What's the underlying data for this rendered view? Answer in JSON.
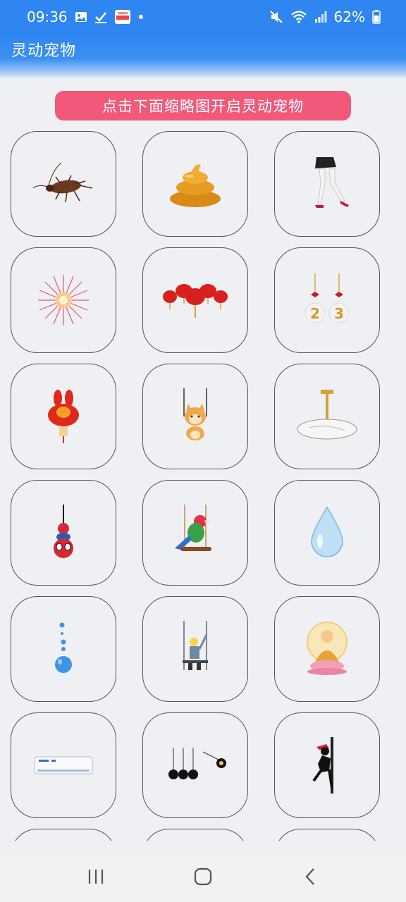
{
  "status_bar": {
    "time": "09:36",
    "battery": "62%",
    "icons": [
      "gallery-icon",
      "checkmark-icon",
      "app-notification-icon",
      "dot-icon",
      "mute-icon",
      "wifi-icon",
      "signal-icon",
      "battery-icon"
    ]
  },
  "header": {
    "title": "灵动宠物"
  },
  "banner": {
    "text": "点击下面缩略图开启灵动宠物"
  },
  "pets": [
    {
      "name": "cockroach-icon"
    },
    {
      "name": "poop-icon"
    },
    {
      "name": "legs-high-heels-icon"
    },
    {
      "name": "firework-icon"
    },
    {
      "name": "red-lanterns-icon"
    },
    {
      "name": "number-23-ornaments-icon"
    },
    {
      "name": "rabbit-lantern-icon"
    },
    {
      "name": "shiba-swing-icon"
    },
    {
      "name": "ceiling-fan-icon"
    },
    {
      "name": "spiderman-hanging-icon"
    },
    {
      "name": "parrot-swing-icon"
    },
    {
      "name": "water-drop-icon"
    },
    {
      "name": "bubble-drop-icon"
    },
    {
      "name": "window-cleaner-icon"
    },
    {
      "name": "buddha-icon"
    },
    {
      "name": "air-conditioner-icon"
    },
    {
      "name": "newtons-cradle-icon"
    },
    {
      "name": "pole-climber-icon"
    }
  ],
  "navigation": {
    "buttons": [
      "recents-button",
      "home-button",
      "back-button"
    ]
  },
  "colors": {
    "primary": "#2f86f0",
    "banner": "#f1587a",
    "background": "#eef0f3"
  }
}
